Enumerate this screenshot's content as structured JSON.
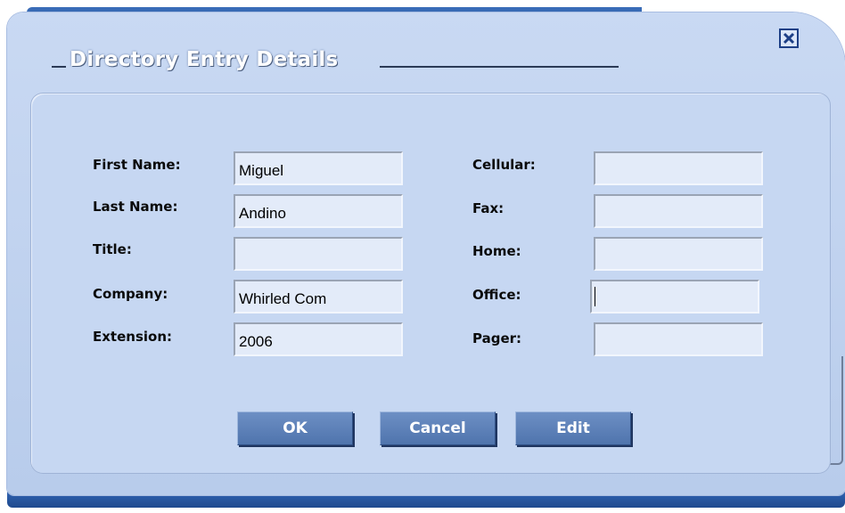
{
  "dialog": {
    "title": "Directory Entry Details"
  },
  "fields_left": [
    {
      "label": "First Name:",
      "value": "Miguel"
    },
    {
      "label": "Last Name:",
      "value": "Andino"
    },
    {
      "label": "Title:",
      "value": ""
    },
    {
      "label": "Company:",
      "value": "Whirled Com"
    },
    {
      "label": "Extension:",
      "value": "2006"
    }
  ],
  "fields_right": [
    {
      "label": "Cellular:",
      "value": ""
    },
    {
      "label": "Fax:",
      "value": ""
    },
    {
      "label": "Home:",
      "value": ""
    },
    {
      "label": "Office:",
      "value": ""
    },
    {
      "label": "Pager:",
      "value": ""
    }
  ],
  "buttons": {
    "ok": "OK",
    "cancel": "Cancel",
    "edit": "Edit"
  },
  "icons": {
    "close": "close-icon"
  },
  "colors": {
    "window_bg": "#c9d9f3",
    "title_bar": "#2c5aa0",
    "button_bg": "#5c80b8",
    "field_bg": "#e3ebf9"
  }
}
